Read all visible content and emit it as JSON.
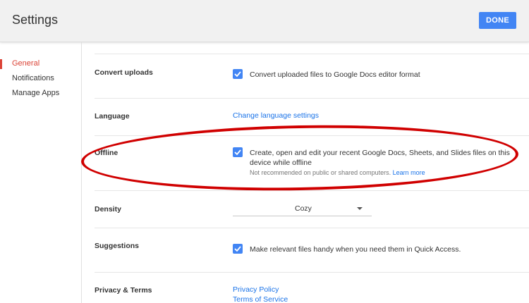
{
  "header": {
    "title": "Settings",
    "done_label": "DONE"
  },
  "sidebar": {
    "items": [
      {
        "label": "General",
        "active": true
      },
      {
        "label": "Notifications",
        "active": false
      },
      {
        "label": "Manage Apps",
        "active": false
      }
    ]
  },
  "settings": {
    "convert_uploads": {
      "label": "Convert uploads",
      "checked": true,
      "text": "Convert uploaded files to Google Docs editor format"
    },
    "language": {
      "label": "Language",
      "link": "Change language settings"
    },
    "offline": {
      "label": "Offline",
      "checked": true,
      "text_line1": "Create, open and edit your recent Google Docs, Sheets, and Slides files on this",
      "text_line2": "device while offline",
      "note": "Not recommended on public or shared computers.",
      "learn_more": "Learn more"
    },
    "density": {
      "label": "Density",
      "value": "Cozy"
    },
    "suggestions": {
      "label": "Suggestions",
      "checked": true,
      "text": "Make relevant files handy when you need them in Quick Access."
    },
    "privacy": {
      "label": "Privacy & Terms",
      "links": [
        "Privacy Policy",
        "Terms of Service"
      ]
    }
  },
  "colors": {
    "accent": "#4285f4",
    "active_nav": "#db4437",
    "annotation": "#d00000",
    "link": "#1a73e8"
  }
}
